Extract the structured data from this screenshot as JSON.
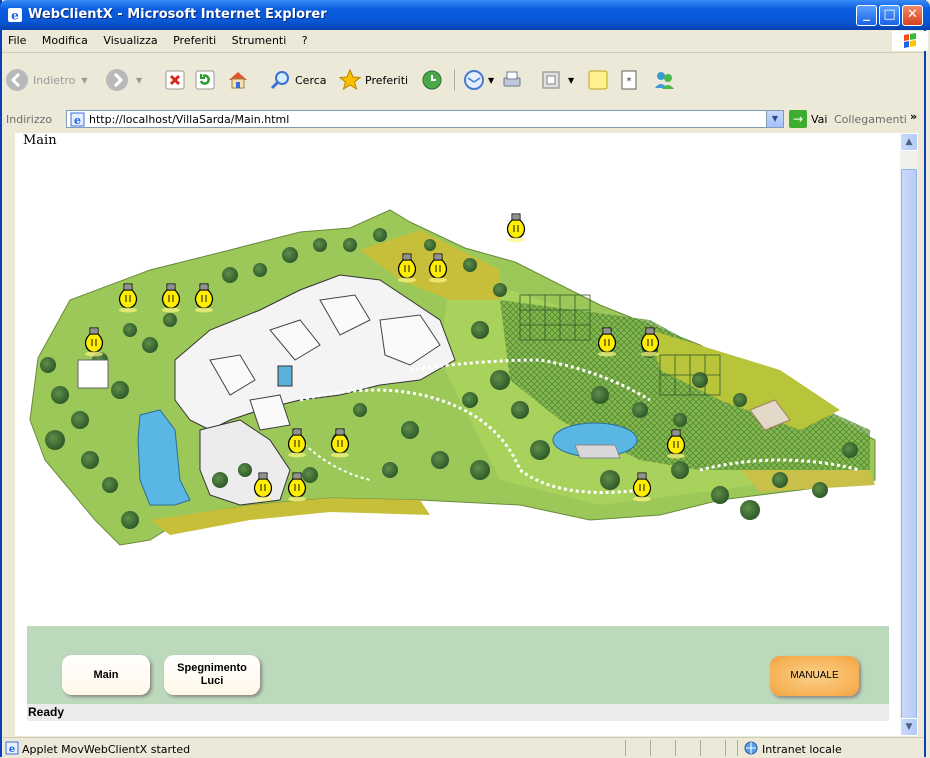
{
  "window": {
    "title": "WebClientX - Microsoft Internet Explorer"
  },
  "menu": [
    "File",
    "Modifica",
    "Visualizza",
    "Preferiti",
    "Strumenti",
    "?"
  ],
  "toolbar": {
    "back_label": "Indietro",
    "search_label": "Cerca",
    "favorites_label": "Preferiti"
  },
  "address": {
    "label": "Indirizzo",
    "url": "http://localhost/VillaSarda/Main.html",
    "go_label": "Vai",
    "links_label": "Collegamenti"
  },
  "page": {
    "heading": "Main"
  },
  "app": {
    "buttons": {
      "main": "Main",
      "lights_off_line1": "Spegnimento",
      "lights_off_line2": "Luci",
      "manual": "MANUALE"
    },
    "status": "Ready"
  },
  "status_bar": {
    "text": "Applet MovWebClientX started",
    "zone": "Intranet locale"
  },
  "colors": {
    "title_bar": "#0a58d6",
    "panel_bg": "#bcd9bc",
    "manual_button": "#f7b257",
    "light_bulb": "#ffee00"
  },
  "icons": [
    "ie-icon",
    "back-icon",
    "forward-icon",
    "stop-icon",
    "refresh-icon",
    "home-icon",
    "search-icon",
    "favorites-icon",
    "history-icon",
    "mail-icon",
    "print-icon",
    "edit-icon",
    "notes-icon",
    "research-icon",
    "messenger-icon",
    "go-icon",
    "light-bulb-icon"
  ]
}
